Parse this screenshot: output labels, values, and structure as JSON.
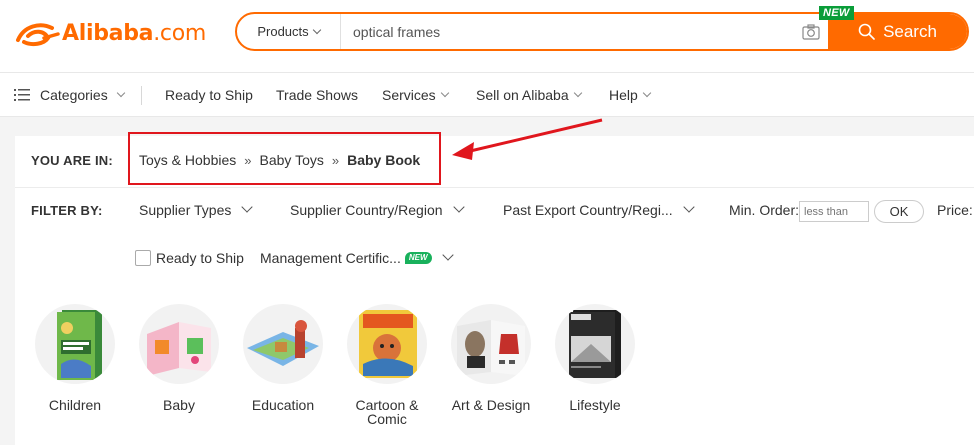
{
  "header": {
    "logo_text": "Alibaba",
    "logo_suffix": ".com",
    "search": {
      "category": "Products",
      "query": "optical frames",
      "button_label": "Search",
      "badge": "NEW"
    }
  },
  "nav": {
    "categories": "Categories",
    "ready_to_ship": "Ready to Ship",
    "trade_shows": "Trade Shows",
    "services": "Services",
    "sell": "Sell on Alibaba",
    "help": "Help"
  },
  "breadcrumb": {
    "label": "YOU ARE IN:",
    "items": [
      "Toys & Hobbies",
      "Baby Toys",
      "Baby Book"
    ],
    "separator": "»"
  },
  "filters": {
    "label": "FILTER BY:",
    "supplier_types": "Supplier Types",
    "supplier_country": "Supplier Country/Region",
    "past_export": "Past Export Country/Regi...",
    "min_order_label": "Min. Order:",
    "min_order_placeholder": "less than",
    "ok": "OK",
    "price_label": "Price:",
    "ready_to_ship": "Ready to Ship",
    "management": "Management Certific...",
    "new_badge": "NEW"
  },
  "categories": [
    {
      "label": "Children",
      "icon": "children-book-icon"
    },
    {
      "label": "Baby",
      "icon": "baby-book-icon"
    },
    {
      "label": "Education",
      "icon": "education-book-icon"
    },
    {
      "label": "Cartoon &\nComic",
      "icon": "cartoon-book-icon"
    },
    {
      "label": "Art & Design",
      "icon": "art-book-icon"
    },
    {
      "label": "Lifestyle",
      "icon": "lifestyle-book-icon"
    }
  ],
  "colors": {
    "brand": "#ff6a00",
    "annotation": "#e0161d",
    "new_badge": "#0a9d39"
  }
}
